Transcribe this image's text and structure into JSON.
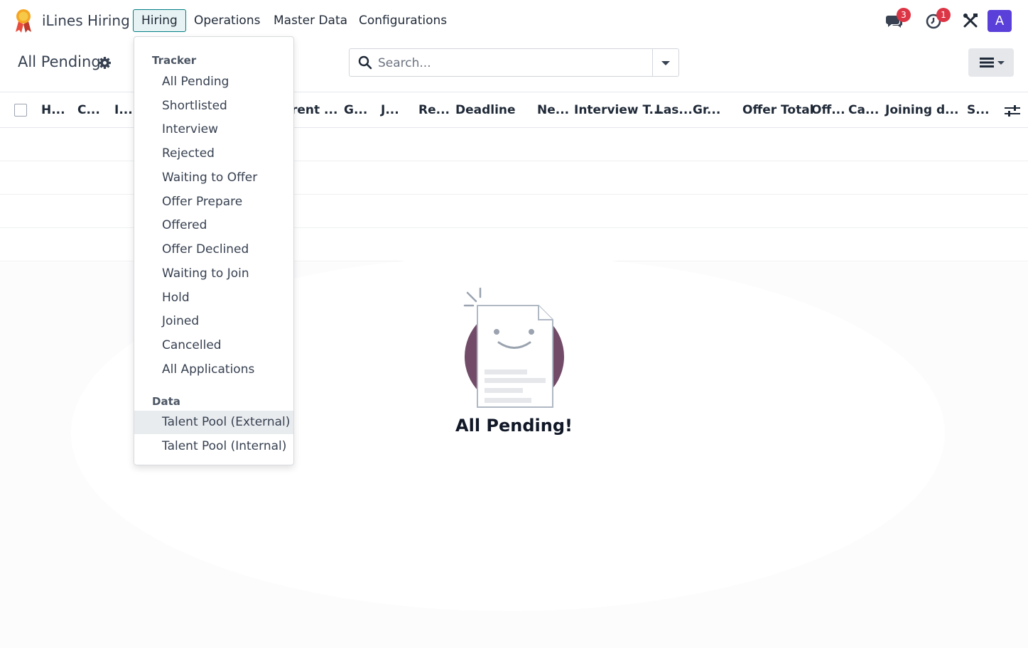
{
  "app": {
    "brand": "iLines Hiring"
  },
  "nav": {
    "menus": [
      {
        "label": "Hiring",
        "active": true
      },
      {
        "label": "Operations"
      },
      {
        "label": "Master Data"
      },
      {
        "label": "Configurations"
      }
    ],
    "messages_badge": "3",
    "activities_badge": "1",
    "avatar_initial": "A",
    "avatar_color": "#5b3fd9"
  },
  "control_panel": {
    "title": "All Pending",
    "search_placeholder": "Search..."
  },
  "list": {
    "columns": [
      "H...",
      "C...",
      "I...",
      "rent ...",
      "G...",
      "J...",
      "Re...",
      "Deadline",
      "Ne...",
      "Interview T...",
      "Las...",
      "Gr...",
      "Offer Total",
      "Off...",
      "Ca...",
      "Joining d...",
      "S..."
    ]
  },
  "empty_state": {
    "title": "All Pending!"
  },
  "dropdown": {
    "section_tracker": "Tracker",
    "tracker_items": [
      "All Pending",
      "Shortlisted",
      "Interview",
      "Rejected",
      "Waiting to Offer",
      "Offer Prepare",
      "Offered",
      "Offer Declined",
      "Waiting to Join",
      "Hold",
      "Joined",
      "Cancelled",
      "All Applications"
    ],
    "section_data": "Data",
    "data_items": [
      "Talent Pool (External)",
      "Talent Pool (Internal)"
    ]
  },
  "colors": {
    "accent": "#017e84",
    "brand_primary": "#714b67",
    "badge": "#dc3545"
  }
}
